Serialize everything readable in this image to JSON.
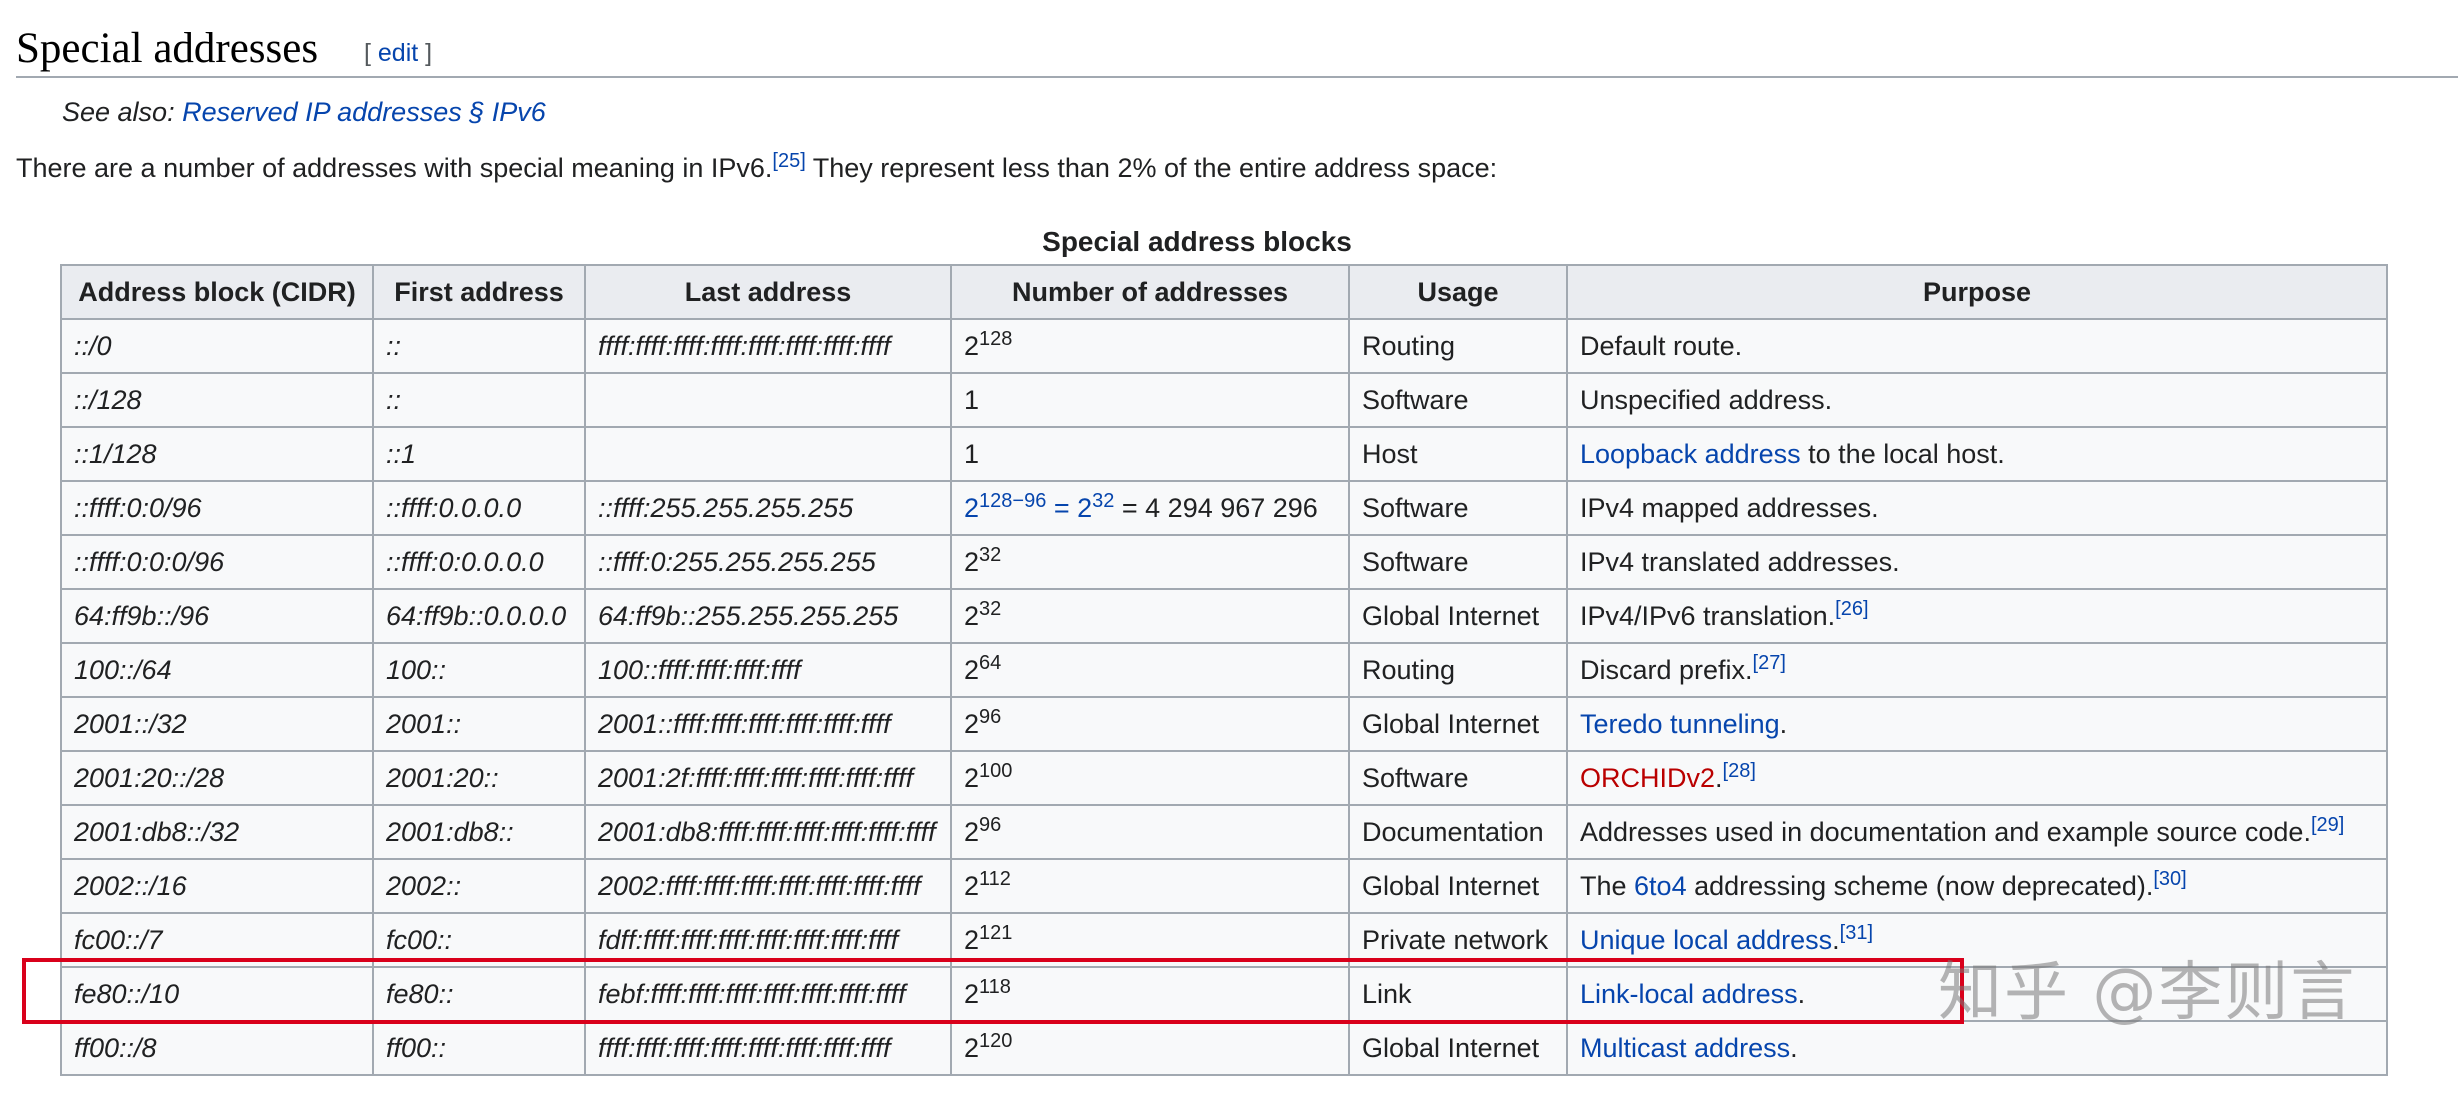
{
  "heading": {
    "title": "Special addresses",
    "edit_open": "[ ",
    "edit_label": "edit",
    "edit_close": " ]"
  },
  "see_also": {
    "prefix": "See also: ",
    "link": "Reserved IP addresses § IPv6"
  },
  "intro": {
    "text_before": "There are a number of addresses with special meaning in IPv6.",
    "ref": "[25]",
    "text_after": " They represent less than 2% of the entire address space:"
  },
  "table": {
    "caption": "Special address blocks",
    "headers": [
      "Address block (CIDR)",
      "First address",
      "Last address",
      "Number of addresses",
      "Usage",
      "Purpose"
    ],
    "rows": [
      {
        "cidr": "::/0",
        "first": "::",
        "last": "ffff:ffff:ffff:ffff:ffff:ffff:ffff:ffff",
        "num_base": "2",
        "num_exp": "128",
        "usage": "Routing",
        "purpose": "Default route."
      },
      {
        "cidr": "::/128",
        "first": "::",
        "last": "",
        "num_base": "1",
        "num_exp": "",
        "usage": "Software",
        "purpose": "Unspecified address."
      },
      {
        "cidr": "::1/128",
        "first": "::1",
        "last": "",
        "num_base": "1",
        "num_exp": "",
        "usage": "Host",
        "purpose_link": "Loopback address",
        "purpose_after": " to the local host."
      },
      {
        "cidr": "::ffff:0:0/96",
        "first": "::ffff:0.0.0.0",
        "last": "::ffff:255.255.255.255",
        "num_link_a": "2",
        "num_link_a_exp": "128−96",
        "num_link_eq": " = ",
        "num_link_b": "2",
        "num_link_b_exp": "32",
        "num_after": " = 4 294 967 296",
        "usage": "Software",
        "purpose": "IPv4 mapped addresses."
      },
      {
        "cidr": "::ffff:0:0:0/96",
        "first": "::ffff:0:0.0.0.0",
        "last": "::ffff:0:255.255.255.255",
        "num_base": "2",
        "num_exp": "32",
        "usage": "Software",
        "purpose": "IPv4 translated addresses."
      },
      {
        "cidr": "64:ff9b::/96",
        "first": "64:ff9b::0.0.0.0",
        "last": "64:ff9b::255.255.255.255",
        "num_base": "2",
        "num_exp": "32",
        "usage": "Global Internet",
        "purpose": "IPv4/IPv6 translation.",
        "ref": "[26]"
      },
      {
        "cidr": "100::/64",
        "first": "100::",
        "last": "100::ffff:ffff:ffff:ffff",
        "num_base": "2",
        "num_exp": "64",
        "usage": "Routing",
        "purpose": "Discard prefix.",
        "ref": "[27]"
      },
      {
        "cidr": "2001::/32",
        "first": "2001::",
        "last": "2001::ffff:ffff:ffff:ffff:ffff:ffff",
        "num_base": "2",
        "num_exp": "96",
        "usage": "Global Internet",
        "purpose_link": "Teredo tunneling",
        "purpose_after": "."
      },
      {
        "cidr": "2001:20::/28",
        "first": "2001:20::",
        "last": "2001:2f:ffff:ffff:ffff:ffff:ffff:ffff",
        "num_base": "2",
        "num_exp": "100",
        "usage": "Software",
        "purpose_newlink": "ORCHIDv2",
        "purpose_after": ".",
        "ref": "[28]"
      },
      {
        "cidr": "2001:db8::/32",
        "first": "2001:db8::",
        "last": "2001:db8:ffff:ffff:ffff:ffff:ffff:ffff",
        "num_base": "2",
        "num_exp": "96",
        "usage": "Documentation",
        "purpose": "Addresses used in documentation and example source code.",
        "ref": "[29]"
      },
      {
        "cidr": "2002::/16",
        "first": "2002::",
        "last": "2002:ffff:ffff:ffff:ffff:ffff:ffff:ffff",
        "num_base": "2",
        "num_exp": "112",
        "usage": "Global Internet",
        "purpose_before": "The ",
        "purpose_link": "6to4",
        "purpose_after": " addressing scheme (now deprecated).",
        "ref": "[30]"
      },
      {
        "cidr": "fc00::/7",
        "first": "fc00::",
        "last": "fdff:ffff:ffff:ffff:ffff:ffff:ffff:ffff",
        "num_base": "2",
        "num_exp": "121",
        "usage": "Private network",
        "purpose_link": "Unique local address",
        "purpose_after": ".",
        "ref": "[31]"
      },
      {
        "cidr": "fe80::/10",
        "first": "fe80::",
        "last": "febf:ffff:ffff:ffff:ffff:ffff:ffff:ffff",
        "num_base": "2",
        "num_exp": "118",
        "usage": "Link",
        "purpose_link": "Link-local address",
        "purpose_after": "."
      },
      {
        "cidr": "ff00::/8",
        "first": "ff00::",
        "last": "ffff:ffff:ffff:ffff:ffff:ffff:ffff:ffff",
        "num_base": "2",
        "num_exp": "120",
        "usage": "Global Internet",
        "purpose_link": "Multicast address",
        "purpose_after": "."
      }
    ]
  },
  "watermark": "知乎 @李则言",
  "colors": {
    "link": "#0645ad",
    "new_link": "#ba0000",
    "highlight_border": "#d9001b",
    "table_border": "#a2a9b1",
    "header_bg": "#eaecf0",
    "cell_bg": "#f8f9fa"
  }
}
